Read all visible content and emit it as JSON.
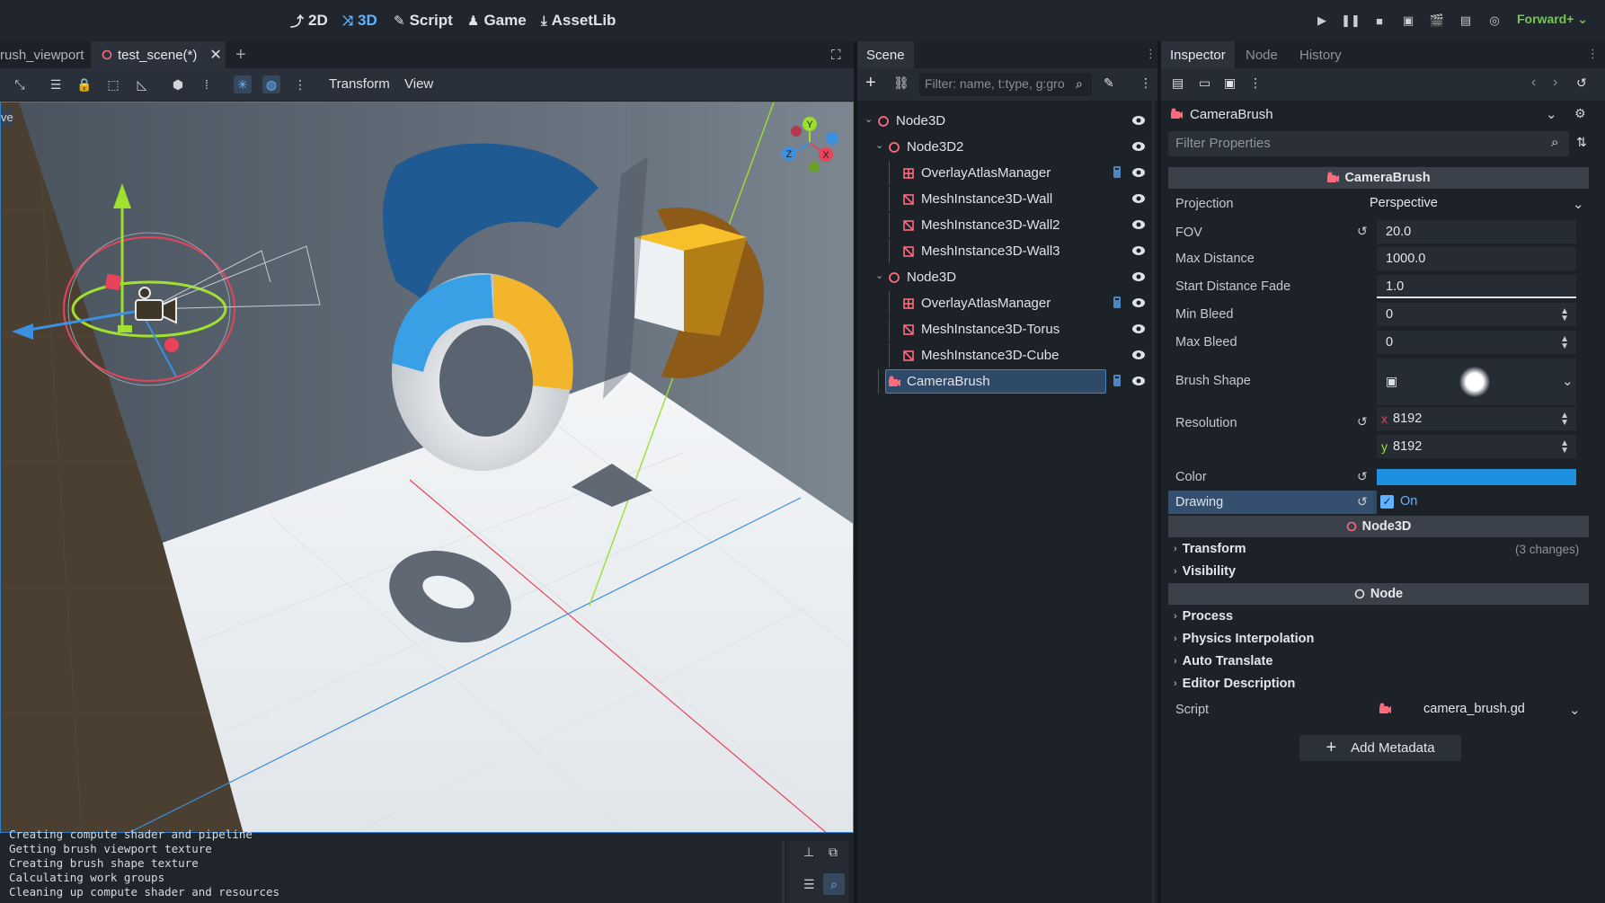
{
  "topbar": {
    "workspaces": [
      {
        "label": "2D",
        "glyph": "⤴"
      },
      {
        "label": "3D",
        "glyph": "⤨"
      },
      {
        "label": "Script",
        "glyph": "✎"
      },
      {
        "label": "Game",
        "glyph": "♟"
      },
      {
        "label": "AssetLib",
        "glyph": "⤓"
      }
    ],
    "active_workspace": "3D",
    "renderer": "Forward+",
    "renderer_color": "#72c94b"
  },
  "viewport": {
    "tabs": [
      {
        "label": "rush_viewport"
      },
      {
        "label": "test_scene(*)"
      }
    ],
    "menus": {
      "transform": "Transform",
      "view": "View"
    },
    "side_label": "ve",
    "gizmo": {
      "y": "Y",
      "x": "X",
      "z": "Z"
    }
  },
  "output": {
    "lines": [
      "Creating compute shader and pipeline",
      "Getting brush viewport texture",
      "Creating brush shape texture",
      "Calculating work groups",
      "Cleaning up compute shader and resources"
    ]
  },
  "scene": {
    "tab": "Scene",
    "filter_placeholder": "Filter: name, t:type, g:gro",
    "tree": [
      {
        "label": "Node3D",
        "depth": 0,
        "expand": "⌄",
        "type": "node3d"
      },
      {
        "label": "Node3D2",
        "depth": 1,
        "expand": "⌄",
        "type": "node3d"
      },
      {
        "label": "OverlayAtlasManager",
        "depth": 2,
        "expand": "",
        "type": "manager",
        "script": true
      },
      {
        "label": "MeshInstance3D-Wall",
        "depth": 2,
        "expand": "",
        "type": "mesh"
      },
      {
        "label": "MeshInstance3D-Wall2",
        "depth": 2,
        "expand": "",
        "type": "mesh"
      },
      {
        "label": "MeshInstance3D-Wall3",
        "depth": 2,
        "expand": "",
        "type": "mesh"
      },
      {
        "label": "Node3D",
        "depth": 1,
        "expand": "⌄",
        "type": "node3d"
      },
      {
        "label": "OverlayAtlasManager",
        "depth": 2,
        "expand": "",
        "type": "manager",
        "script": true
      },
      {
        "label": "MeshInstance3D-Torus",
        "depth": 2,
        "expand": "",
        "type": "mesh"
      },
      {
        "label": "MeshInstance3D-Cube",
        "depth": 2,
        "expand": "",
        "type": "mesh"
      },
      {
        "label": "CameraBrush",
        "depth": 1,
        "expand": "",
        "type": "camera",
        "script": true,
        "selected": true
      }
    ]
  },
  "inspector": {
    "tabs": [
      "Inspector",
      "Node",
      "History"
    ],
    "object": "CameraBrush",
    "filter_placeholder": "Filter Properties",
    "section_camerabrush": "CameraBrush",
    "props": {
      "projection": {
        "name": "Projection",
        "value": "Perspective"
      },
      "fov": {
        "name": "FOV",
        "value": "20.0"
      },
      "max_distance": {
        "name": "Max Distance",
        "value": "1000.0"
      },
      "start_fade": {
        "name": "Start Distance Fade",
        "value": "1.0",
        "slider_fraction": 1.0
      },
      "min_bleed": {
        "name": "Min Bleed",
        "value": "0"
      },
      "max_bleed": {
        "name": "Max Bleed",
        "value": "0"
      },
      "brush_shape": {
        "name": "Brush Shape"
      },
      "resolution": {
        "name": "Resolution",
        "x_label": "x",
        "x": "8192",
        "y_label": "y",
        "y": "8192"
      },
      "color": {
        "name": "Color",
        "value_color": "#1f8fe0"
      },
      "drawing": {
        "name": "Drawing",
        "value": "On"
      }
    },
    "section_node3d": "Node3D",
    "node3d_groups": [
      {
        "label": "Transform",
        "note": "(3 changes)"
      },
      {
        "label": "Visibility",
        "note": ""
      }
    ],
    "section_node": "Node",
    "node_groups": [
      {
        "label": "Process"
      },
      {
        "label": "Physics Interpolation"
      },
      {
        "label": "Auto Translate"
      },
      {
        "label": "Editor Description"
      }
    ],
    "script": {
      "name": "Script",
      "value": "camera_brush.gd"
    },
    "add_metadata": "Add Metadata"
  }
}
